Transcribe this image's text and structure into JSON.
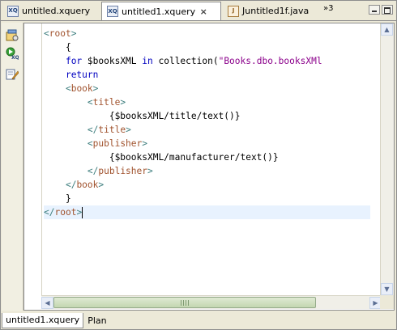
{
  "tabs": [
    {
      "label": "untitled.xquery",
      "icon": "xquery-file-icon",
      "icon_text": "XQ"
    },
    {
      "label": "untitled1.xquery",
      "icon": "xquery-file-icon",
      "icon_text": "XQ",
      "active": true,
      "close": "×"
    },
    {
      "label": "Juntitled1f.java",
      "icon": "java-file-icon",
      "icon_text": "J"
    }
  ],
  "overflow": "»3",
  "code": {
    "l1": {
      "lt": "<",
      "name": "root",
      "gt": ">"
    },
    "l2": "{",
    "l3": {
      "for": "for",
      "var": " $booksXML ",
      "in": "in",
      "rest": " collection(",
      "str": "\"Books.dbo.booksXMl"
    },
    "l4": "return",
    "l5": {
      "lt": "<",
      "name": "book",
      "gt": ">"
    },
    "l6": {
      "lt": "<",
      "name": "title",
      "gt": ">"
    },
    "l7": "{$booksXML/title/text()}",
    "l8": {
      "lt": "</",
      "name": "title",
      "gt": ">"
    },
    "l9": {
      "lt": "<",
      "name": "publisher",
      "gt": ">"
    },
    "l10": "{$booksXML/manufacturer/text()}",
    "l11": {
      "lt": "</",
      "name": "publisher",
      "gt": ">"
    },
    "l12": {
      "lt": "</",
      "name": "book",
      "gt": ">"
    },
    "l13": "}",
    "l14": {
      "lt": "</",
      "name": "root",
      "gt": ">"
    }
  },
  "bottom_tabs": [
    "untitled1.xquery",
    "Plan"
  ],
  "colors": {
    "tag": "#3f7f7f",
    "element_name": "#a0522d",
    "keyword": "#0000c0",
    "string": "#8b008b",
    "current_line": "#e8f2fe"
  }
}
